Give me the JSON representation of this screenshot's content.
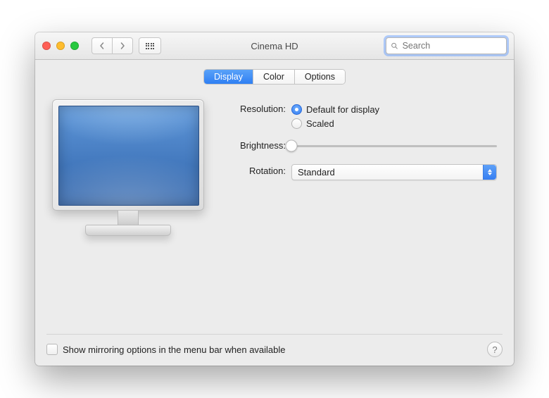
{
  "window": {
    "title": "Cinema HD"
  },
  "search": {
    "placeholder": "Search"
  },
  "tabs": {
    "display": "Display",
    "color": "Color",
    "options": "Options"
  },
  "labels": {
    "resolution": "Resolution:",
    "brightness": "Brightness:",
    "rotation": "Rotation:"
  },
  "resolution": {
    "default_for_display": "Default for display",
    "scaled": "Scaled",
    "selected": "default"
  },
  "brightness": {
    "value": 0
  },
  "rotation": {
    "value": "Standard"
  },
  "footer": {
    "mirroring_label": "Show mirroring options in the menu bar when available"
  },
  "help": {
    "glyph": "?"
  }
}
